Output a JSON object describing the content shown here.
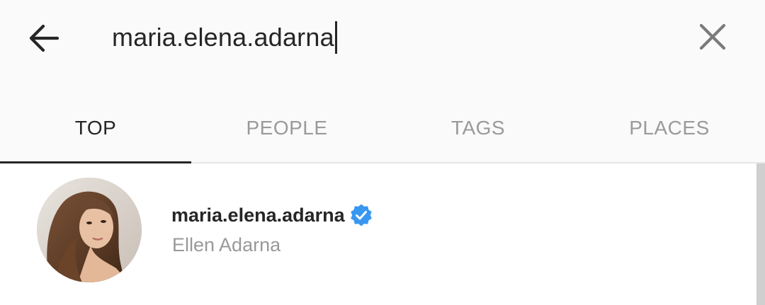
{
  "search": {
    "query": "maria.elena.adarna"
  },
  "tabs": [
    {
      "label": "TOP",
      "active": true
    },
    {
      "label": "PEOPLE",
      "active": false
    },
    {
      "label": "TAGS",
      "active": false
    },
    {
      "label": "PLACES",
      "active": false
    }
  ],
  "results": [
    {
      "username": "maria.elena.adarna",
      "full_name": "Ellen Adarna",
      "verified": true
    }
  ],
  "icons": {
    "back": "arrow-left-icon",
    "clear": "close-icon",
    "verified": "verified-badge-icon"
  },
  "colors": {
    "verified_blue": "#3897f0",
    "active_tab": "#262626",
    "inactive_tab": "#9a9a9a",
    "header_bg": "#fafafa"
  }
}
